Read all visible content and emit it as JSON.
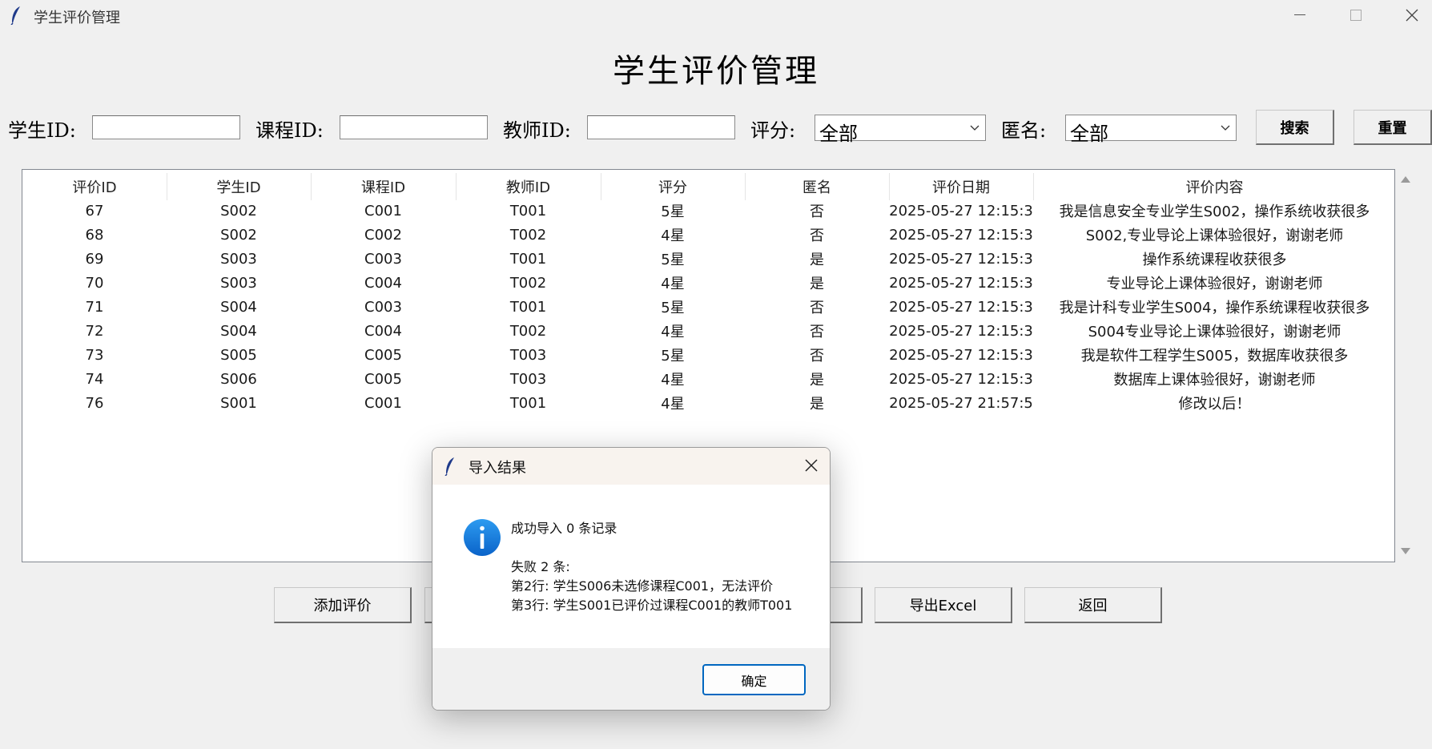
{
  "window": {
    "title": "学生评价管理"
  },
  "page": {
    "title": "学生评价管理"
  },
  "filters": {
    "student_id_label": "学生ID:",
    "student_id_value": "",
    "course_id_label": "课程ID:",
    "course_id_value": "",
    "teacher_id_label": "教师ID:",
    "teacher_id_value": "",
    "rating_label": "评分:",
    "rating_value": "全部",
    "anonymous_label": "匿名:",
    "anonymous_value": "全部",
    "search_label": "搜索",
    "reset_label": "重置"
  },
  "table": {
    "columns": [
      "评价ID",
      "学生ID",
      "课程ID",
      "教师ID",
      "评分",
      "匿名",
      "评价日期",
      "评价内容"
    ],
    "rows": [
      [
        "67",
        "S002",
        "C001",
        "T001",
        "5星",
        "否",
        "2025-05-27 12:15:3",
        "我是信息安全专业学生S002，操作系统收获很多"
      ],
      [
        "68",
        "S002",
        "C002",
        "T002",
        "4星",
        "否",
        "2025-05-27 12:15:3",
        "S002,专业导论上课体验很好，谢谢老师"
      ],
      [
        "69",
        "S003",
        "C003",
        "T001",
        "5星",
        "是",
        "2025-05-27 12:15:3",
        "操作系统课程收获很多"
      ],
      [
        "70",
        "S003",
        "C004",
        "T002",
        "4星",
        "是",
        "2025-05-27 12:15:3",
        "专业导论上课体验很好，谢谢老师"
      ],
      [
        "71",
        "S004",
        "C003",
        "T001",
        "5星",
        "否",
        "2025-05-27 12:15:3",
        "我是计科专业学生S004，操作系统课程收获很多"
      ],
      [
        "72",
        "S004",
        "C004",
        "T002",
        "4星",
        "否",
        "2025-05-27 12:15:3",
        "S004专业导论上课体验很好，谢谢老师"
      ],
      [
        "73",
        "S005",
        "C005",
        "T003",
        "5星",
        "否",
        "2025-05-27 12:15:3",
        "我是软件工程学生S005，数据库收获很多"
      ],
      [
        "74",
        "S006",
        "C005",
        "T003",
        "4星",
        "是",
        "2025-05-27 12:15:3",
        "数据库上课体验很好，谢谢老师"
      ],
      [
        "76",
        "S001",
        "C001",
        "T001",
        "4星",
        "是",
        "2025-05-27 21:57:5",
        "修改以后！"
      ]
    ]
  },
  "actions": {
    "add_label": "添加评价",
    "export_label": "导出Excel",
    "back_label": "返回"
  },
  "dialog": {
    "title": "导入结果",
    "icon": "info-icon",
    "line1": "成功导入 0 条记录",
    "line2": "失败 2 条:",
    "line3": "第2行: 学生S006未选修课程C001，无法评价",
    "line4": "第3行: 学生S001已评价过课程C001的教师T001",
    "ok_label": "确定"
  },
  "colors": {
    "window_bg": "#f0f0f0",
    "info_blue": "#1378d8",
    "focus_border": "#0067c0"
  }
}
